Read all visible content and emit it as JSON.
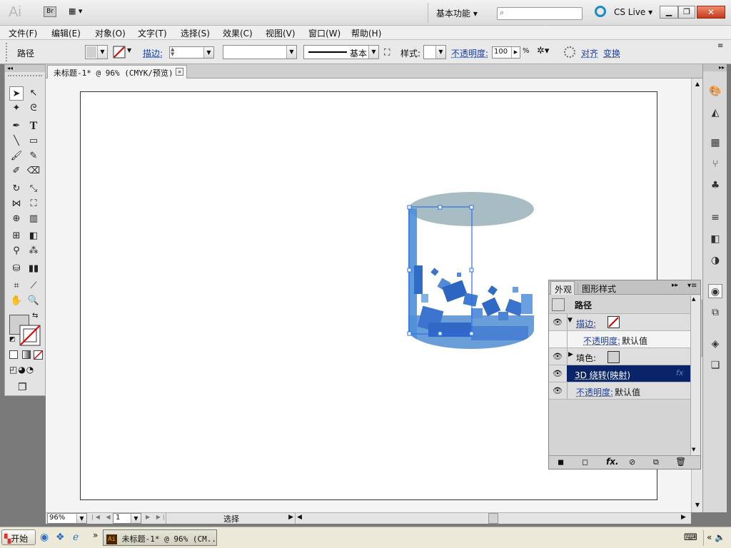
{
  "app": {
    "logo": "Ai",
    "bridge_label": "Br",
    "workspace_label": "基本功能",
    "search_placeholder": "",
    "cslive_label": "CS Live"
  },
  "menu": [
    "文件(F)",
    "编辑(E)",
    "对象(O)",
    "文字(T)",
    "选择(S)",
    "效果(C)",
    "视图(V)",
    "窗口(W)",
    "帮助(H)"
  ],
  "control": {
    "object_type": "路径",
    "stroke_label": "描边:",
    "stroke_width": "",
    "style_preset": "",
    "brush_label": "基本",
    "style_label": "样式:",
    "opacity_label": "不透明度:",
    "opacity_value": "100",
    "opacity_unit": "%",
    "align_label": "对齐",
    "transform_label": "变换"
  },
  "document": {
    "tab_title": "未标题-1* @ 96% (CMYK/预览)"
  },
  "status": {
    "zoom": "96%",
    "page": "1",
    "status_text": "选择"
  },
  "appearance_panel": {
    "tabs": [
      "外观",
      "图形样式"
    ],
    "header_title": "路径",
    "rows": [
      {
        "label": "描边:",
        "value": "",
        "linked": true
      },
      {
        "label": "不透明度:",
        "value": "默认值",
        "linked": true
      },
      {
        "label": "填色:",
        "value": "",
        "linked": false
      },
      {
        "label": "3D 绕转(映射)",
        "value": "",
        "linked": true
      },
      {
        "label": "不透明度:",
        "value": "默认值",
        "linked": true
      }
    ]
  },
  "taskbar": {
    "start_label": "开始",
    "task_label": "未标题-1* @ 96% (CM..."
  },
  "colors": {
    "accent_blue": "#1a3ea8",
    "selected_row": "#0a246a",
    "cylinder_top": "#a8bcc3",
    "selection": "#2a6ff0"
  }
}
